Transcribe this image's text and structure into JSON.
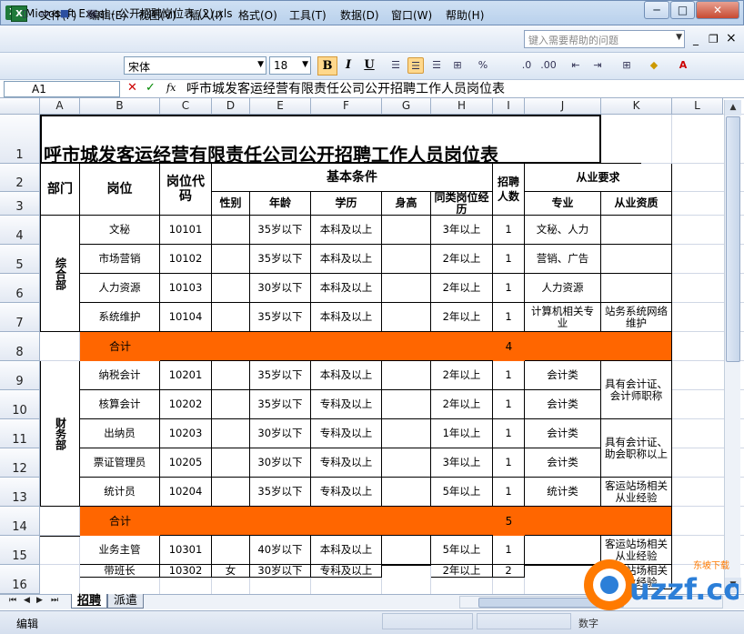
{
  "window": {
    "app_icon": "X",
    "title": "Microsoft Excel - 公开招聘岗位表 (2).xls",
    "min": "─",
    "max": "□",
    "close": "✕"
  },
  "menu": {
    "items": [
      "文件(F)",
      "编辑(E)",
      "视图(V)",
      "插入(I)",
      "格式(O)",
      "工具(T)",
      "数据(D)",
      "窗口(W)",
      "帮助(H)"
    ],
    "help_placeholder": "键入需要帮助的问题",
    "mdi_min": "_",
    "mdi_restore": "❐",
    "mdi_close": "×"
  },
  "toolbar": {
    "font": "宋体",
    "size": "18",
    "bold": "B",
    "italic": "I",
    "underline": "U"
  },
  "formula": {
    "name_box": "A1",
    "content": "呼市城发客运经营有限责任公司公开招聘工作人员岗位表",
    "fx": "fx",
    "cancel": "✕",
    "enter": "✓"
  },
  "grid": {
    "columns": [
      "A",
      "B",
      "C",
      "D",
      "E",
      "F",
      "G",
      "H",
      "I",
      "J",
      "K",
      "L"
    ],
    "rows": [
      "1",
      "2",
      "3",
      "4",
      "5",
      "6",
      "7",
      "8",
      "9",
      "10",
      "11",
      "12",
      "13",
      "14",
      "15",
      "16"
    ],
    "title": "呼市城发客运经营有限责任公司公开招聘工作人员岗位表",
    "header": {
      "dept": "部门",
      "post": "岗位",
      "code": "岗位代码",
      "basic": "基本条件",
      "gender": "性别",
      "age": "年龄",
      "edu": "学历",
      "height": "身高",
      "exp": "同类岗位经历",
      "hire": "招聘人数",
      "req": "从业要求",
      "major": "专业",
      "qual": "从业资质"
    },
    "dept1": "综合部",
    "dept2": "财务部",
    "data_rows": [
      {
        "post": "文秘",
        "code": "10101",
        "gender": "",
        "age": "35岁以下",
        "edu": "本科及以上",
        "height": "",
        "exp": "3年以上",
        "num": "1",
        "major": "文秘、人力",
        "qual": ""
      },
      {
        "post": "市场营销",
        "code": "10102",
        "gender": "",
        "age": "35岁以下",
        "edu": "本科及以上",
        "height": "",
        "exp": "2年以上",
        "num": "1",
        "major": "营销、广告",
        "qual": ""
      },
      {
        "post": "人力资源",
        "code": "10103",
        "gender": "",
        "age": "30岁以下",
        "edu": "本科及以上",
        "height": "",
        "exp": "2年以上",
        "num": "1",
        "major": "人力资源",
        "qual": ""
      },
      {
        "post": "系统维护",
        "code": "10104",
        "gender": "",
        "age": "35岁以下",
        "edu": "本科及以上",
        "height": "",
        "exp": "2年以上",
        "num": "1",
        "major": "计算机相关专业",
        "qual": "站务系统网络维护"
      },
      {
        "post": "合计",
        "code": "",
        "gender": "",
        "age": "",
        "edu": "",
        "height": "",
        "exp": "",
        "num": "4",
        "major": "",
        "qual": ""
      },
      {
        "post": "纳税会计",
        "code": "10201",
        "gender": "",
        "age": "35岁以下",
        "edu": "本科及以上",
        "height": "",
        "exp": "2年以上",
        "num": "1",
        "major": "会计类",
        "qual": ""
      },
      {
        "post": "核算会计",
        "code": "10202",
        "gender": "",
        "age": "35岁以下",
        "edu": "专科及以上",
        "height": "",
        "exp": "2年以上",
        "num": "1",
        "major": "会计类",
        "qual": ""
      },
      {
        "post": "出纳员",
        "code": "10203",
        "gender": "",
        "age": "30岁以下",
        "edu": "专科及以上",
        "height": "",
        "exp": "1年以上",
        "num": "1",
        "major": "会计类",
        "qual": ""
      },
      {
        "post": "票证管理员",
        "code": "10205",
        "gender": "",
        "age": "30岁以下",
        "edu": "专科及以上",
        "height": "",
        "exp": "3年以上",
        "num": "1",
        "major": "会计类",
        "qual": ""
      },
      {
        "post": "统计员",
        "code": "10204",
        "gender": "",
        "age": "35岁以下",
        "edu": "专科及以上",
        "height": "",
        "exp": "5年以上",
        "num": "1",
        "major": "统计类",
        "qual": "客运站场相关从业经验"
      },
      {
        "post": "合计",
        "code": "",
        "gender": "",
        "age": "",
        "edu": "",
        "height": "",
        "exp": "",
        "num": "5",
        "major": "",
        "qual": ""
      },
      {
        "post": "业务主管",
        "code": "10301",
        "gender": "",
        "age": "40岁以下",
        "edu": "本科及以上",
        "height": "",
        "exp": "5年以上",
        "num": "1",
        "major": "",
        "qual": "客运站场相关从业经验"
      },
      {
        "post": "带班长",
        "code": "10302",
        "gender": "女",
        "age": "30岁以下",
        "edu": "专科及以上",
        "height": "",
        "exp": "2年以上",
        "num": "2",
        "major": "",
        "qual": "客运站场相关从业经验"
      }
    ],
    "qual_merged_1": "具有会计证、会计师职称",
    "qual_merged_2": "具有会计证、助会职称以上"
  },
  "sheets": {
    "nav": [
      "⏮",
      "◀",
      "▶",
      "⏭"
    ],
    "tabs": [
      "招聘",
      "派遣"
    ]
  },
  "status": {
    "mode": "编辑",
    "num": "数字"
  },
  "watermark": {
    "text": "uzzf.com",
    "sub": "东坡下载"
  },
  "colors": {
    "total_row": "#ff6600",
    "grid_line": "#d0d7e5",
    "title_bar": "#b9d1ec"
  }
}
